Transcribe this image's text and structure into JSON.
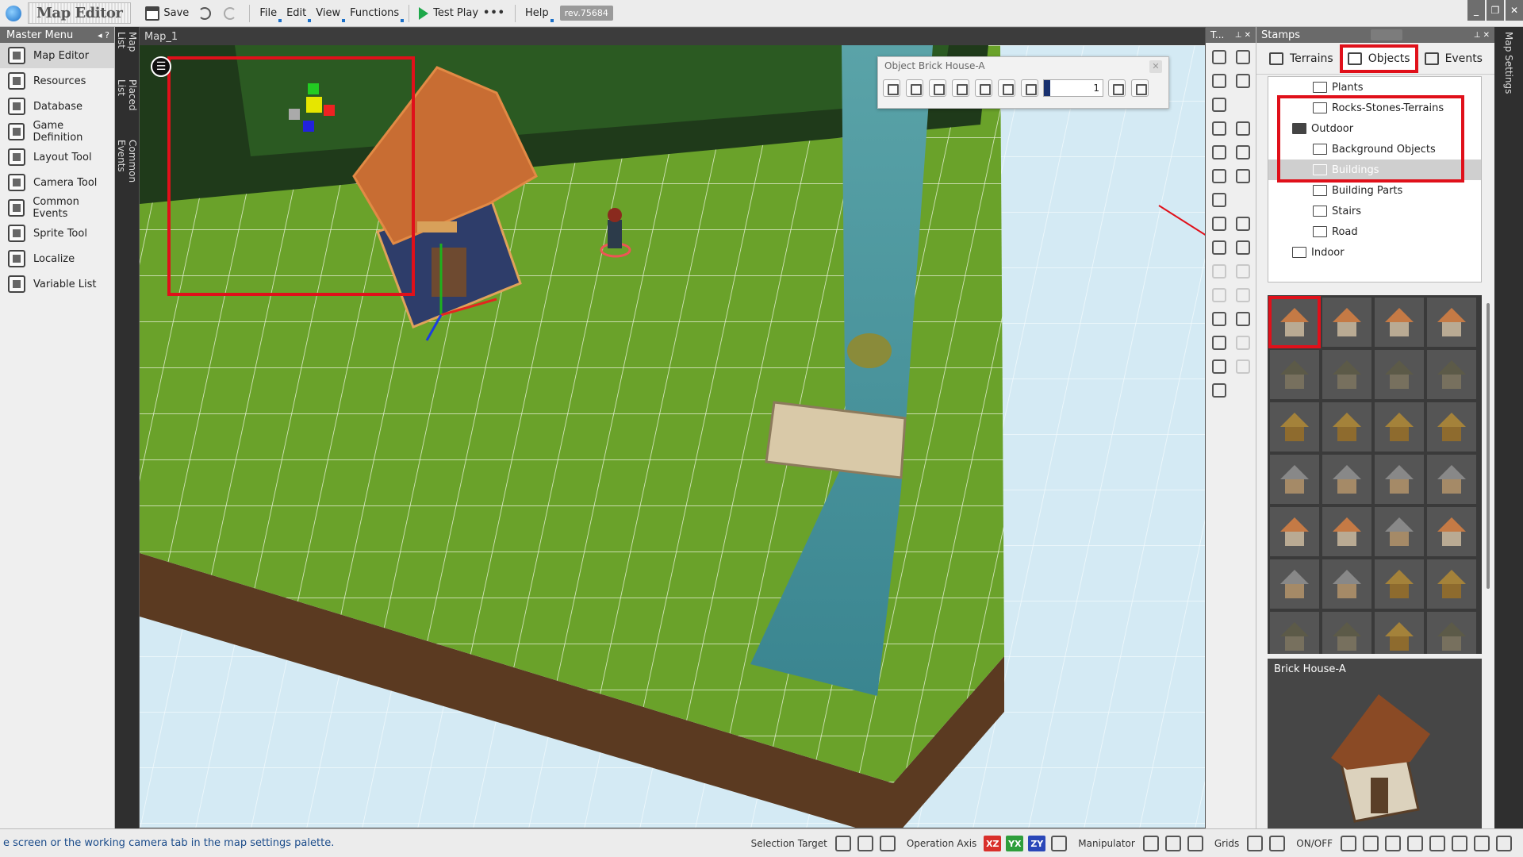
{
  "app": {
    "title": "Map Editor",
    "rev": "rev.75684"
  },
  "toolbar": {
    "save_label": "Save",
    "menus": [
      "File",
      "Edit",
      "View",
      "Functions"
    ],
    "test_play_label": "Test Play",
    "more_label": "•••",
    "help_label": "Help"
  },
  "window_controls": [
    "_",
    "❐",
    "✕"
  ],
  "master_menu": {
    "title": "Master Menu",
    "items": [
      {
        "label": "Map Editor",
        "icon": "map-icon",
        "active": true
      },
      {
        "label": "Resources",
        "icon": "resources-icon"
      },
      {
        "label": "Database",
        "icon": "database-icon"
      },
      {
        "label": "Game Definition",
        "icon": "game-definition-icon"
      },
      {
        "label": "Layout Tool",
        "icon": "layout-icon"
      },
      {
        "label": "Camera Tool",
        "icon": "camera-icon"
      },
      {
        "label": "Common Events",
        "icon": "events-icon"
      },
      {
        "label": "Sprite Tool",
        "icon": "sprite-icon"
      },
      {
        "label": "Localize",
        "icon": "globe-icon"
      },
      {
        "label": "Variable List",
        "icon": "list-icon"
      }
    ]
  },
  "side_tabs": [
    "Map List",
    "Placed List",
    "Common Events"
  ],
  "map": {
    "tab_label": "Map_1"
  },
  "object_toolbar": {
    "title": "Object Brick House-A",
    "value": "1"
  },
  "tool_palette": {
    "title": "T..."
  },
  "stamps": {
    "title": "Stamps",
    "tabs": [
      {
        "label": "Terrains"
      },
      {
        "label": "Objects",
        "active": true
      },
      {
        "label": "Events"
      }
    ],
    "tree": [
      {
        "label": "Plants",
        "depth": 2
      },
      {
        "label": "Rocks-Stones-Terrains",
        "depth": 2
      },
      {
        "label": "Outdoor",
        "depth": 1,
        "open": true
      },
      {
        "label": "Background Objects",
        "depth": 2
      },
      {
        "label": "Buildings",
        "depth": 2,
        "selected": true
      },
      {
        "label": "Building Parts",
        "depth": 2
      },
      {
        "label": "Stairs",
        "depth": 2
      },
      {
        "label": "Road",
        "depth": 2
      },
      {
        "label": "Indoor",
        "depth": 1
      }
    ],
    "preview_title": "Brick House-A"
  },
  "vertical_right_tab": "Map Settings",
  "statusbar": {
    "message": "e screen or the working camera tab in the map settings palette.",
    "selection_target": "Selection Target",
    "operation_axis": "Operation Axis",
    "axes": [
      {
        "label": "XZ",
        "color": "#d9302b"
      },
      {
        "label": "YX",
        "color": "#2e9e3b"
      },
      {
        "label": "ZY",
        "color": "#2a47b8"
      }
    ],
    "manipulator": "Manipulator",
    "grids": "Grids",
    "onoff": "ON/OFF"
  },
  "colors": {
    "highlight": "#e0101a",
    "grass": "#6aa22a",
    "water": "#3f8c95"
  }
}
